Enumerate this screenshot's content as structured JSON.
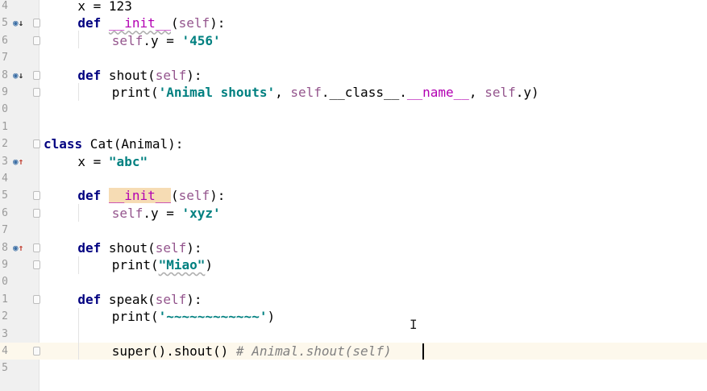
{
  "editor": {
    "lines": [
      {
        "num": "4",
        "marker": "",
        "fold": false,
        "caret": false,
        "indent": 2,
        "parts": [
          {
            "t": "x = 123"
          }
        ]
      },
      {
        "num": "5",
        "marker": "override-down",
        "fold": true,
        "caret": false,
        "indent": 2,
        "parts": [
          {
            "t": "def",
            "c": "kw"
          },
          {
            "t": " "
          },
          {
            "t": "__init__",
            "c": "magic wavy"
          },
          {
            "t": "("
          },
          {
            "t": "self",
            "c": "self"
          },
          {
            "t": "):"
          }
        ]
      },
      {
        "num": "6",
        "marker": "",
        "fold": true,
        "caret": false,
        "indent": 4,
        "parts": [
          {
            "t": "self",
            "c": "self"
          },
          {
            "t": ".y = "
          },
          {
            "t": "'456'",
            "c": "str"
          }
        ]
      },
      {
        "num": "7",
        "marker": "",
        "fold": false,
        "caret": false,
        "indent": 0,
        "parts": []
      },
      {
        "num": "8",
        "marker": "override-down",
        "fold": true,
        "caret": false,
        "indent": 2,
        "parts": [
          {
            "t": "def",
            "c": "kw"
          },
          {
            "t": " shout("
          },
          {
            "t": "self",
            "c": "self"
          },
          {
            "t": "):"
          }
        ]
      },
      {
        "num": "9",
        "marker": "",
        "fold": true,
        "caret": false,
        "indent": 4,
        "parts": [
          {
            "t": "print("
          },
          {
            "t": "'Animal shouts'",
            "c": "str"
          },
          {
            "t": ", "
          },
          {
            "t": "self",
            "c": "self"
          },
          {
            "t": ".__class__."
          },
          {
            "t": "__name__",
            "c": "magic"
          },
          {
            "t": ", "
          },
          {
            "t": "self",
            "c": "self"
          },
          {
            "t": ".y)"
          }
        ]
      },
      {
        "num": "0",
        "marker": "",
        "fold": false,
        "caret": false,
        "indent": 0,
        "parts": []
      },
      {
        "num": "1",
        "marker": "",
        "fold": false,
        "caret": false,
        "indent": 0,
        "parts": []
      },
      {
        "num": "2",
        "marker": "",
        "fold": true,
        "caret": false,
        "indent": 0,
        "parts": [
          {
            "t": "class",
            "c": "kw"
          },
          {
            "t": " Cat(Animal):"
          }
        ]
      },
      {
        "num": "3",
        "marker": "override-up",
        "fold": false,
        "caret": false,
        "indent": 2,
        "parts": [
          {
            "t": "x = "
          },
          {
            "t": "\"abc\"",
            "c": "str"
          }
        ]
      },
      {
        "num": "4",
        "marker": "",
        "fold": false,
        "caret": false,
        "indent": 0,
        "parts": []
      },
      {
        "num": "5",
        "marker": "",
        "fold": true,
        "caret": false,
        "indent": 2,
        "parts": [
          {
            "t": "def",
            "c": "kw"
          },
          {
            "t": " "
          },
          {
            "t": "__init__",
            "c": "magic hl"
          },
          {
            "t": "("
          },
          {
            "t": "self",
            "c": "self"
          },
          {
            "t": "):"
          }
        ]
      },
      {
        "num": "6",
        "marker": "",
        "fold": true,
        "caret": false,
        "indent": 4,
        "parts": [
          {
            "t": "self",
            "c": "self"
          },
          {
            "t": ".y = "
          },
          {
            "t": "'xyz'",
            "c": "str"
          }
        ]
      },
      {
        "num": "7",
        "marker": "",
        "fold": false,
        "caret": false,
        "indent": 0,
        "parts": []
      },
      {
        "num": "8",
        "marker": "override-up",
        "fold": true,
        "caret": false,
        "indent": 2,
        "parts": [
          {
            "t": "def",
            "c": "kw"
          },
          {
            "t": " shout("
          },
          {
            "t": "self",
            "c": "self"
          },
          {
            "t": "):"
          }
        ]
      },
      {
        "num": "9",
        "marker": "",
        "fold": true,
        "caret": false,
        "indent": 4,
        "parts": [
          {
            "t": "print("
          },
          {
            "t": "\"Miao\"",
            "c": "str wavy"
          },
          {
            "t": ")"
          }
        ]
      },
      {
        "num": "0",
        "marker": "",
        "fold": false,
        "caret": false,
        "indent": 0,
        "parts": []
      },
      {
        "num": "1",
        "marker": "",
        "fold": true,
        "caret": false,
        "indent": 2,
        "parts": [
          {
            "t": "def",
            "c": "kw"
          },
          {
            "t": " speak("
          },
          {
            "t": "self",
            "c": "self"
          },
          {
            "t": "):"
          }
        ]
      },
      {
        "num": "2",
        "marker": "",
        "fold": false,
        "caret": false,
        "indent": 4,
        "parts": [
          {
            "t": "print("
          },
          {
            "t": "'~~~~~~~~~~~~'",
            "c": "str"
          },
          {
            "t": ")"
          }
        ]
      },
      {
        "num": "3",
        "marker": "",
        "fold": false,
        "caret": false,
        "indent": 0,
        "parts": []
      },
      {
        "num": "4",
        "marker": "",
        "fold": true,
        "caret": true,
        "indent": 4,
        "parts": [
          {
            "t": "super().shout() "
          },
          {
            "t": "# Animal.shout(self)",
            "c": "comment"
          }
        ]
      },
      {
        "num": "5",
        "marker": "",
        "fold": false,
        "caret": false,
        "indent": 0,
        "parts": []
      }
    ]
  },
  "icons": {
    "override_down": "overridden-method-icon",
    "override_up": "overriding-method-icon",
    "mouse": "text-cursor-icon"
  },
  "colors": {
    "keyword": "#000080",
    "self": "#94558d",
    "magic": "#b200b2",
    "string": "#008080",
    "comment": "#808080",
    "gutter": "#f0f0f0",
    "caret_row": "#fdf8ec"
  }
}
